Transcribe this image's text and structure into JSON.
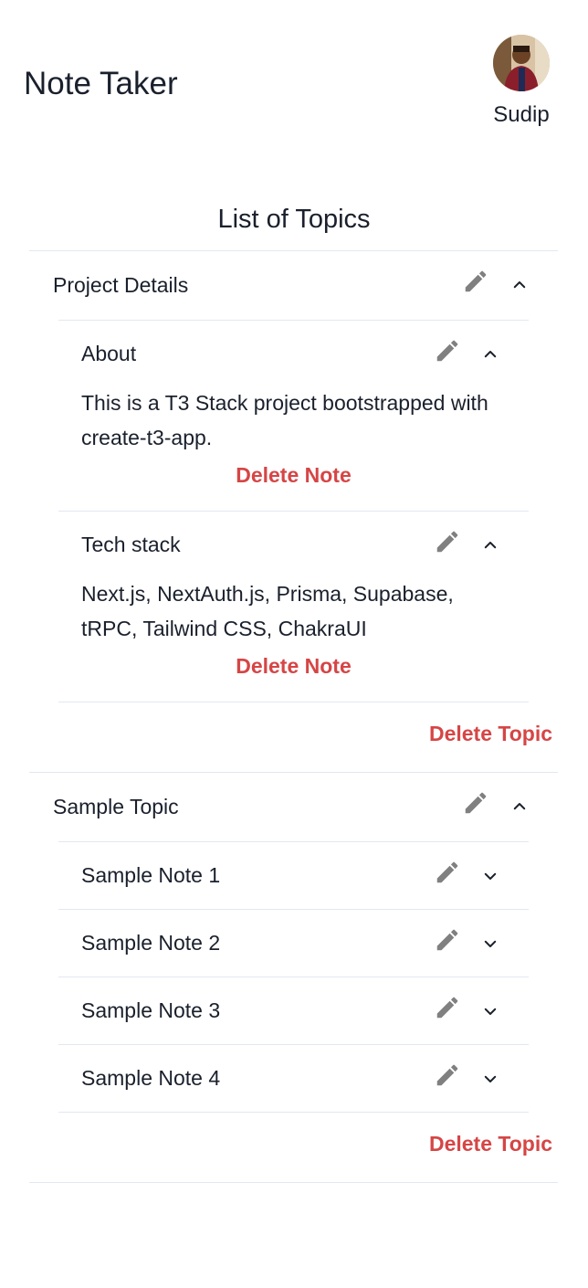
{
  "app": {
    "title": "Note Taker"
  },
  "user": {
    "name": "Sudip"
  },
  "section": {
    "title": "List of Topics"
  },
  "topics": [
    {
      "title": "Project Details",
      "expanded": true,
      "notes": [
        {
          "title": "About",
          "expanded": true,
          "content": "This is a T3 Stack project bootstrapped with create-t3-app.",
          "delete_label": "Delete Note"
        },
        {
          "title": "Tech stack",
          "expanded": true,
          "content": "Next.js, NextAuth.js, Prisma, Supabase, tRPC, Tailwind CSS, ChakraUI",
          "delete_label": "Delete Note"
        }
      ],
      "delete_label": "Delete Topic"
    },
    {
      "title": "Sample Topic",
      "expanded": true,
      "notes": [
        {
          "title": "Sample Note 1",
          "expanded": false
        },
        {
          "title": "Sample Note 2",
          "expanded": false
        },
        {
          "title": "Sample Note 3",
          "expanded": false
        },
        {
          "title": "Sample Note 4",
          "expanded": false
        }
      ],
      "delete_label": "Delete Topic"
    }
  ],
  "colors": {
    "danger": "#d64545",
    "icon": "#808080",
    "divider": "#e2e8f0",
    "text": "#1a202c"
  },
  "icons": {
    "edit": "pencil-icon",
    "expanded": "chevron-up-icon",
    "collapsed": "chevron-down-icon"
  }
}
